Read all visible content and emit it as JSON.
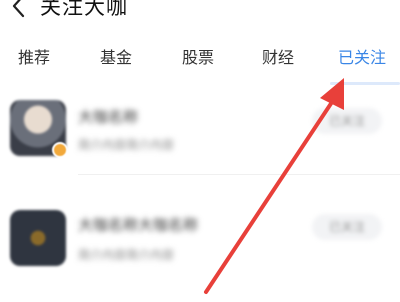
{
  "header": {
    "title": "关注大咖",
    "back_icon": "back-chevron-icon"
  },
  "tabs": [
    {
      "label": "推荐",
      "active": false
    },
    {
      "label": "基金",
      "active": false
    },
    {
      "label": "股票",
      "active": false
    },
    {
      "label": "财经",
      "active": false
    },
    {
      "label": "已关注",
      "active": true
    }
  ],
  "followed_list": [
    {
      "name": "大咖名称",
      "description": "简介内容简介内容",
      "button_label": "已关注"
    },
    {
      "name": "大咖名称大咖名称",
      "description": "简介内容简介内容",
      "button_label": "已关注"
    }
  ],
  "colors": {
    "accent": "#3a86e6",
    "annotation_arrow": "#e8403a"
  }
}
